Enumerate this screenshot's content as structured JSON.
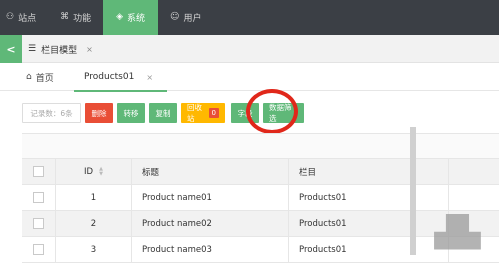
{
  "topnav": {
    "items": [
      {
        "icon": "org-icon",
        "glyph": "⚇",
        "label": "站点"
      },
      {
        "icon": "function-icon",
        "glyph": "⌘",
        "label": "功能"
      },
      {
        "icon": "layers-icon",
        "glyph": "◈",
        "label": "系统"
      },
      {
        "icon": "user-icon",
        "glyph": "☺",
        "label": "用户"
      }
    ],
    "active_index": 2,
    "accent": "#5fb878"
  },
  "tabstrip": {
    "toggle_glyph": "<",
    "tab_icon_glyph": "☰",
    "tab_label": "栏目模型",
    "close_glyph": "×"
  },
  "subtabs": {
    "home_icon_glyph": "⌂",
    "home_label": "首页",
    "active_label": "Products01",
    "close_glyph": "×"
  },
  "toolbar": {
    "count_label": "记录数：6条",
    "delete_label": "删除",
    "move_label": "转移",
    "copy_label": "复制",
    "recycle_label": "回收站",
    "recycle_badge": "0",
    "fields_label": "字段",
    "filter_label": "数据筛选"
  },
  "table": {
    "headers": [
      "ID",
      "标题",
      "栏目"
    ],
    "rows": [
      {
        "id": "1",
        "title": "Product name01",
        "column": "Products01"
      },
      {
        "id": "2",
        "title": "Product name02",
        "column": "Products01"
      },
      {
        "id": "3",
        "title": "Product name03",
        "column": "Products01"
      }
    ]
  },
  "colors": {
    "green": "#5fb878",
    "red": "#e94e36",
    "orange": "#ffb800",
    "highlight": "#e0271a",
    "nav_bg": "#3b3f45"
  }
}
